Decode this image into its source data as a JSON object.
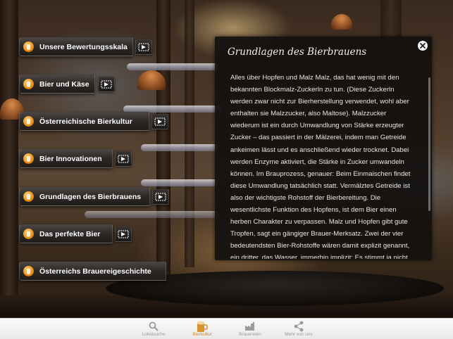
{
  "menu": {
    "items": [
      {
        "label": "Unsere Bewertungsskala"
      },
      {
        "label": "Bier und Käse"
      },
      {
        "label": "Österreichische Bierkultur"
      },
      {
        "label": "Bier Innovationen"
      },
      {
        "label": "Grundlagen des Bierbrauens"
      },
      {
        "label": "Das perfekte Bier"
      },
      {
        "label": "Österreichs Brauereigeschichte"
      }
    ]
  },
  "panel": {
    "title": "Grundlagen des Bierbrauens",
    "body": "Alles über Hopfen und Malz Malz, das hat wenig mit den bekannten Blockmalz-Zuckerln zu tun. (Diese Zuckerln werden zwar nicht zur Bierherstellung verwendet, wohl aber enthalten sie Malzzucker, also Maltose). Malzzucker wiederum ist ein durch Umwandlung von Stärke erzeugter Zucker – das passiert in der Mälzerei, indem man Getreide ankeimen lässt und es anschließend wieder trocknet. Dabei werden Enzyme aktiviert, die Stärke in Zucker umwandeln können. Im Brauprozess, genauer: Beim Einmaischen findet diese Umwandlung tatsächlich statt. Vermälztes Getreide ist also der wichtigste Rohstoff der Bierbereitung. Die wesentlichste Funktion des Hopfens, ist dem Bier einen herben Charakter zu verpassen. Malz und Hopfen gibt gute Tropfen, sagt ein gängiger Brauer-Merksatz. Zwei der vier bedeutendsten Bier-Rohstoffe wären damit explizit genannt, ein dritter, das Wasser, immerhin implizit: Es stimmt ja nicht, wenn man Bier salopp als „Gerstensaft“ bezeichnet – die Gerste hat, ob vermälzt oder unvermälzt, nur einen"
  },
  "tabbar": {
    "tabs": [
      {
        "label": "Lokalsuche",
        "icon": "search-icon",
        "active": false
      },
      {
        "label": "Bierkultur",
        "icon": "beer-mug-icon",
        "active": true
      },
      {
        "label": "Brauereien",
        "icon": "factory-icon",
        "active": false
      },
      {
        "label": "Mehr von uns",
        "icon": "share-icon",
        "active": false
      }
    ]
  },
  "colors": {
    "accent": "#c98a2a",
    "beer_badge": "#e88d16",
    "panel_bg": "#121010",
    "tab_inactive": "#9a9a9a"
  }
}
